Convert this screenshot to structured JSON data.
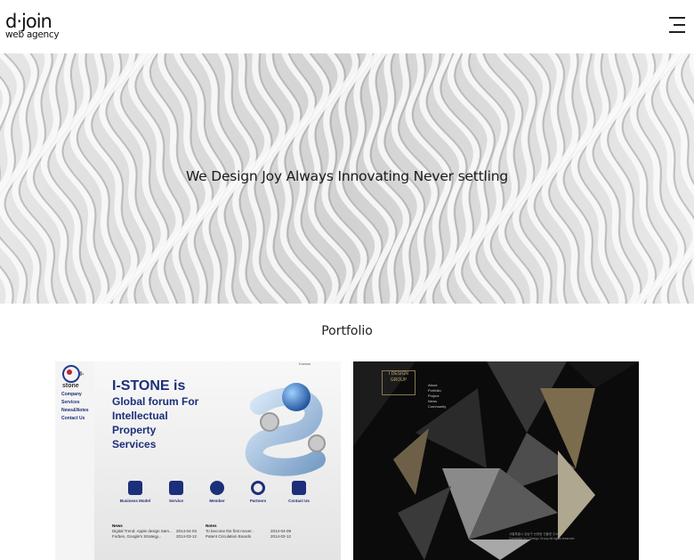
{
  "header": {
    "logo_main": "d·join",
    "logo_sub": "web agency",
    "menu_icon": "hamburger-menu-icon"
  },
  "hero": {
    "tagline": "We Design Joy Always Innovating Never settling"
  },
  "portfolio": {
    "title": "Portfolio",
    "items": [
      {
        "logo": "I-stone",
        "nav": [
          "Company",
          "Services",
          "News&Notes",
          "Contact Us"
        ],
        "top_link": "Korean",
        "headline_1": "I-STONE is",
        "headline_2": "Global forum For",
        "headline_3": "Intellectual",
        "headline_4": "Property",
        "headline_5": "Services",
        "icons": [
          "Business Model",
          "Service",
          "Member",
          "Partners",
          "Contact Us"
        ],
        "news_title": "News",
        "news_1": "Digital Trend: Apple design Sam...",
        "news_1_date": "2014-04-03",
        "news_2": "Forbes, Google's Strategy...",
        "news_2_date": "2014-03-12",
        "notes_title": "Notes",
        "notes_1": "To become the first mover..",
        "notes_1_date": "2014-04-09",
        "notes_2": "Patent Circulation Boards",
        "notes_2_date": "2014-02-12"
      },
      {
        "logo_1": "I DESIGN",
        "logo_2": "GROUP",
        "nav": [
          "About",
          "Portfolio",
          "Project",
          "News",
          "Community"
        ],
        "footer_1": "서울특별시 강남구 논현동 건물명 주소",
        "footer_2": "Copyright (c) I Design Group All rights reserved",
        "accent": "#8a7a55"
      }
    ]
  }
}
